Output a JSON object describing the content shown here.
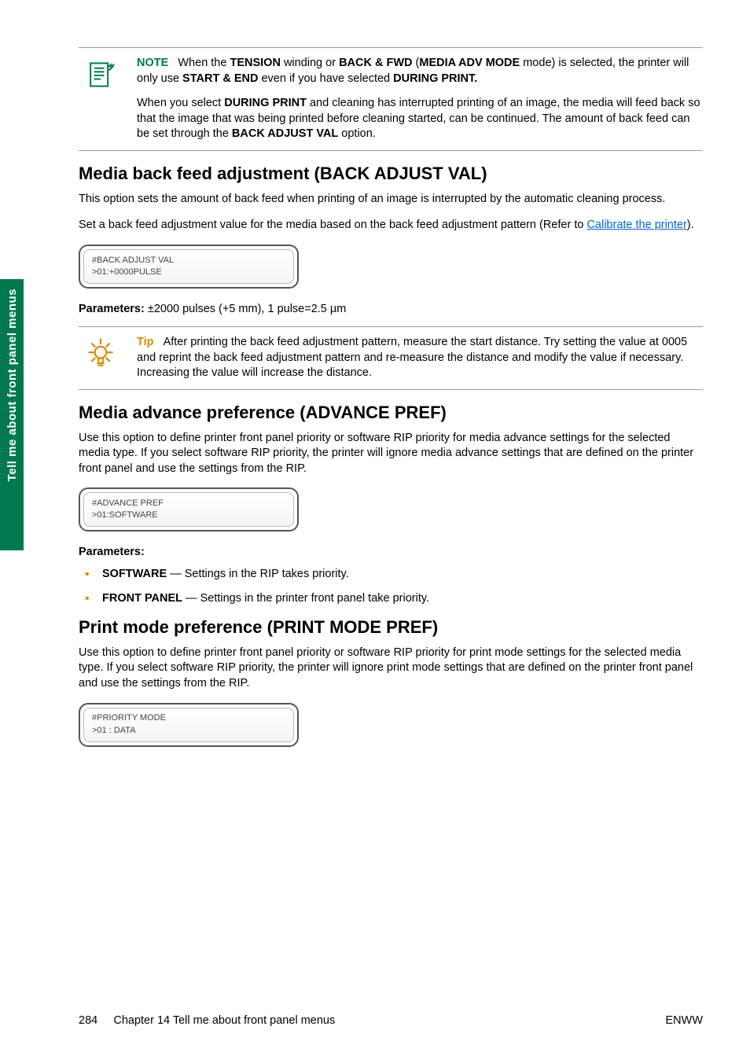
{
  "sidebar": {
    "label": "Tell me about front panel menus"
  },
  "note1": {
    "label": "NOTE",
    "p1_pre": "When the ",
    "b1": "TENSION",
    "t1": " winding or ",
    "b2": "BACK & FWD",
    "t2": " (",
    "b3": "MEDIA ADV MODE",
    "t3": " mode) is selected, the printer will only use ",
    "b4": "START & END",
    "t4": " even if you have selected ",
    "b5": "DURING PRINT.",
    "p2_pre": "When you select ",
    "p2_b1": "DURING PRINT",
    "p2_t1": " and cleaning has interrupted printing of an image, the media will feed back so that the image that was being printed before cleaning started, can be continued. The amount of back feed can be set through the ",
    "p2_b2": "BACK ADJUST VAL",
    "p2_t2": " option."
  },
  "section1": {
    "heading": "Media back feed adjustment (BACK ADJUST VAL)",
    "p1": "This option sets the amount of back feed when printing of an image is interrupted by the automatic cleaning process.",
    "p2_pre": "Set a back feed adjustment value for the media based on the back feed adjustment pattern (Refer to ",
    "p2_link": "Calibrate the printer",
    "p2_post": ").",
    "lcd1": "#BACK ADJUST VAL",
    "lcd2": ">01:+0000PULSE",
    "params_label": "Parameters: ",
    "params_value": "±2000 pulses (+5 mm), 1 pulse=2.5 µm"
  },
  "tip1": {
    "label": "Tip",
    "text": "After printing the back feed adjustment pattern, measure the start distance. Try setting the value at 0005 and reprint the back feed adjustment pattern and re-measure the distance and modify the value if necessary. Increasing the value will increase the distance."
  },
  "section2": {
    "heading": "Media advance preference (ADVANCE PREF)",
    "p1": "Use this option to define printer front panel priority or software RIP priority for media advance settings for the selected media type. If you select software RIP priority, the printer will ignore media advance settings that are defined on the printer front panel and use the settings from the RIP.",
    "lcd1": "#ADVANCE PREF",
    "lcd2": ">01:SOFTWARE",
    "params_label": "Parameters:",
    "bullets": [
      {
        "b": "SOFTWARE ",
        "t": " — Settings in the RIP takes priority."
      },
      {
        "b": "FRONT PANEL",
        "t": " — Settings in the printer front panel take priority."
      }
    ]
  },
  "section3": {
    "heading": "Print mode preference (PRINT MODE PREF)",
    "p1": "Use this option to define printer front panel priority or software RIP priority for print mode settings for the selected media type. If you select software RIP priority, the printer will ignore print mode settings that are defined on the printer front panel and use the settings from the RIP.",
    "lcd1": "#PRIORITY MODE",
    "lcd2": ">01 : DATA"
  },
  "footer": {
    "page": "284",
    "chapter": "Chapter 14   Tell me about front panel menus",
    "right": "ENWW"
  }
}
